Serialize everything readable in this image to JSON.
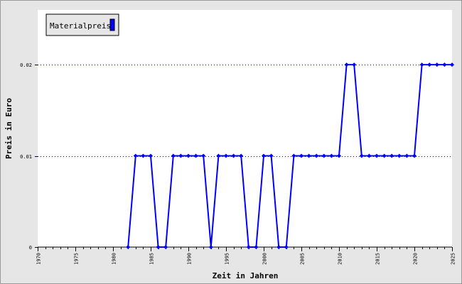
{
  "chart_data": {
    "type": "line",
    "title": "",
    "xlabel": "Zeit in Jahren",
    "ylabel": "Preis in Euro",
    "xlim": [
      1970,
      2025
    ],
    "ylim": [
      0,
      0.026
    ],
    "x_ticks": [
      1970,
      1975,
      1980,
      1985,
      1990,
      1995,
      2000,
      2005,
      2010,
      2015,
      2020,
      2025
    ],
    "y_ticks": [
      0,
      0.01,
      0.02
    ],
    "y_tick_labels": [
      "0",
      "0.01",
      "0.02"
    ],
    "grid": "horizontal dotted at y ticks",
    "legend_position": "top-left",
    "series": [
      {
        "name": "Materialpreis",
        "color": "#0000ff",
        "x": [
          1982,
          1983,
          1984,
          1985,
          1986,
          1987,
          1988,
          1989,
          1990,
          1991,
          1992,
          1993,
          1994,
          1995,
          1996,
          1997,
          1998,
          1999,
          2000,
          2001,
          2002,
          2003,
          2004,
          2005,
          2006,
          2007,
          2008,
          2009,
          2010,
          2011,
          2012,
          2013,
          2014,
          2015,
          2016,
          2017,
          2018,
          2019,
          2020,
          2021,
          2022,
          2023,
          2024,
          2025
        ],
        "y": [
          0,
          0.01,
          0.01,
          0.01,
          0,
          0,
          0.01,
          0.01,
          0.01,
          0.01,
          0.01,
          0,
          0.01,
          0.01,
          0.01,
          0.01,
          0,
          0,
          0.01,
          0.01,
          0,
          0,
          0.01,
          0.01,
          0.01,
          0.01,
          0.01,
          0.01,
          0.01,
          0.02,
          0.02,
          0.01,
          0.01,
          0.01,
          0.01,
          0.01,
          0.01,
          0.01,
          0.01,
          0.02,
          0.02,
          0.02,
          0.02,
          0.02
        ]
      }
    ]
  },
  "colors": {
    "background": "#e6e6e6",
    "plot_area": "#ffffff",
    "series": "#0000ff",
    "grid": "#0000cc"
  }
}
